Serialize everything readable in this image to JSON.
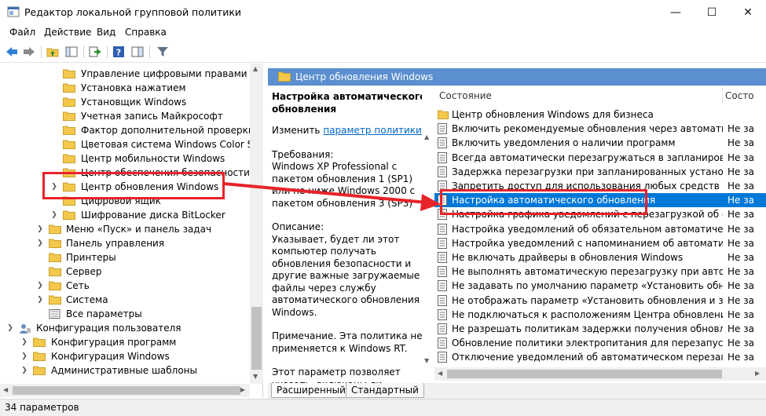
{
  "window": {
    "title": "Редактор локальной групповой политики"
  },
  "menu": {
    "items": [
      "Файл",
      "Действие",
      "Вид",
      "Справка"
    ]
  },
  "tree": {
    "items": [
      "Управление цифровыми правами Windows",
      "Установка нажатием",
      "Установщик Windows",
      "Учетная запись Майкрософт",
      "Фактор дополнительной проверки подлинности",
      "Цветовая система Windows Color System",
      "Центр мобильности Windows",
      "Центр обеспечения безопасности",
      "Центр обновления Windows",
      "Цифровой ящик",
      "Шифрование диска BitLocker",
      "Меню «Пуск» и панель задач",
      "Панель управления",
      "Принтеры",
      "Сервер",
      "Сеть",
      "Система",
      "Все параметры",
      "Конфигурация пользователя",
      "Конфигурация программ",
      "Конфигурация Windows",
      "Административные шаблоны"
    ]
  },
  "right": {
    "header": "Центр обновления Windows",
    "desc": {
      "title": "Настройка автоматического обновления",
      "edit_prefix": "Изменить ",
      "edit_link": "параметр политики",
      "req_label": "Требования:",
      "req_text": "Windows XP Professional с пакетом обновления 1 (SP1) или не ниже Windows 2000 с пакетом обновления 3 (SP3)",
      "desc_label": "Описание:",
      "desc_text": "Указывает, будет ли этот компьютер получать обновления безопасности и другие важные загружаемые файлы через службу автоматического обновления Windows.",
      "note": "Примечание. Эта политика не применяется к Windows RT.",
      "more": "Этот параметр позволяет указать, включены ли"
    },
    "columns": {
      "name": "Состояние",
      "state": "Состо"
    },
    "rows": [
      {
        "name": "Центр обновления Windows для бизнеса",
        "state": "",
        "folder": true
      },
      {
        "name": "Включить рекомендуемые обновления через автоматическое обновление",
        "state": "Не за"
      },
      {
        "name": "Включить уведомления о наличии программ",
        "state": "Не за"
      },
      {
        "name": "Всегда автоматически перезагружаться в запланированное время",
        "state": "Не за"
      },
      {
        "name": "Задержка перезагрузки при запланированных установках",
        "state": "Не за"
      },
      {
        "name": "Запретить доступ для использования любых средств Центра обновления",
        "state": "Не за"
      },
      {
        "name": "Настройка автоматического обновления",
        "state": "Не за",
        "selected": true
      },
      {
        "name": "Настройка графика уведомлений с перезагрузкой об обновлениях",
        "state": "Не за"
      },
      {
        "name": "Настройка уведомлений об обязательном автоматическом перезапуске",
        "state": "Не за"
      },
      {
        "name": "Настройка уведомлений с напоминанием об автоматическом перезапуске",
        "state": "Не за"
      },
      {
        "name": "Не включать драйверы в обновления Windows",
        "state": "Не за"
      },
      {
        "name": "Не выполнять автоматическую перезагрузку при автоматической установке",
        "state": "Не за"
      },
      {
        "name": "Не задавать по умолчанию параметр «Установить обновления и завершить работу»",
        "state": "Не за"
      },
      {
        "name": "Не отображать параметр «Установить обновления и завершить работу»",
        "state": "Не за"
      },
      {
        "name": "Не подключаться к расположениям Центра обновления Windows в Интернете",
        "state": "Не за"
      },
      {
        "name": "Не разрешать политикам задержки получения обновлений",
        "state": "Не за"
      },
      {
        "name": "Обновление политики электропитания для перезапуска",
        "state": "Не за"
      },
      {
        "name": "Отключение уведомлений об автоматическом перезапуске",
        "state": "Не за"
      }
    ],
    "tabs": [
      "Расширенный",
      "Стандартный"
    ]
  },
  "status": "34 параметров",
  "colors": {
    "header": "#5b8fcf",
    "selection": "#0078d7",
    "annotation": "#e8232a",
    "folder": "#f3c84d"
  }
}
